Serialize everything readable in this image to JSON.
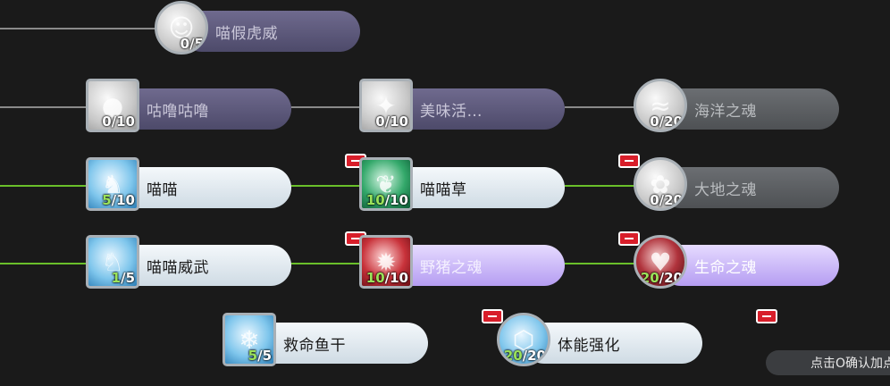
{
  "colors": {
    "link_locked": "#8a8a8a",
    "link_active": "#6abf2a",
    "minus_badge": "#d81e2a",
    "level_highlight": "#9be35a"
  },
  "skills": [
    {
      "id": "miao-jia-hu-wei",
      "name": "喵假虎威",
      "current": "0",
      "max": "5",
      "state": "locked-purple",
      "icon": "cat-face-icon"
    },
    {
      "id": "gu-lu-gu-lu",
      "name": "咕噜咕噜",
      "current": "0",
      "max": "10",
      "state": "locked-purple",
      "icon": "bubbles-icon"
    },
    {
      "id": "mei-wei-huo",
      "name": "美味活…",
      "current": "0",
      "max": "10",
      "state": "locked-purple",
      "icon": "fish-school-icon"
    },
    {
      "id": "hai-yang-zhi-hun",
      "name": "海洋之魂",
      "current": "0",
      "max": "20",
      "state": "locked-grey",
      "icon": "wave-icon"
    },
    {
      "id": "miao-miao",
      "name": "喵喵",
      "current": "5",
      "max": "10",
      "state": "active-blue",
      "icon": "cats-icon"
    },
    {
      "id": "miao-miao-cao",
      "name": "喵喵草",
      "current": "10",
      "max": "10",
      "state": "active-blue",
      "icon": "catnip-leaf-icon"
    },
    {
      "id": "da-di-zhi-hun",
      "name": "大地之魂",
      "current": "0",
      "max": "20",
      "state": "locked-grey",
      "icon": "flower-icon"
    },
    {
      "id": "miao-miao-wei-wu",
      "name": "喵喵威武",
      "current": "1",
      "max": "5",
      "state": "active-blue",
      "icon": "cat-pounce-icon"
    },
    {
      "id": "ye-zhu-zhi-hun",
      "name": "野猪之魂",
      "current": "10",
      "max": "10",
      "state": "active-purple",
      "icon": "boar-icon"
    },
    {
      "id": "sheng-ming-zhi-hun",
      "name": "生命之魂",
      "current": "20",
      "max": "20",
      "state": "active-purple",
      "icon": "heart-icon"
    },
    {
      "id": "jiu-ming-yu-gan",
      "name": "救命鱼干",
      "current": "5",
      "max": "5",
      "state": "active-blue",
      "icon": "dried-fish-icon"
    },
    {
      "id": "ti-neng-qiang-hua",
      "name": "体能强化",
      "current": "20",
      "max": "20",
      "state": "active-blue",
      "icon": "body-shield-icon"
    }
  ],
  "confirm_hint": "点击O确认加点"
}
